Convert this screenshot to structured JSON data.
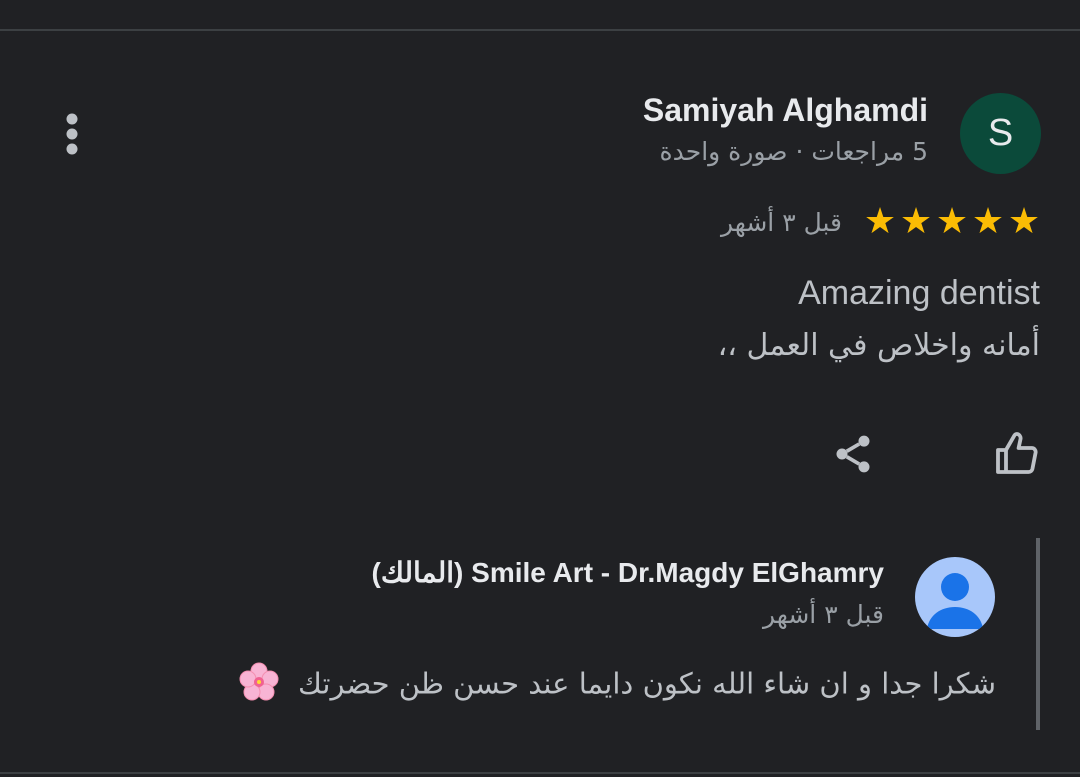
{
  "review": {
    "reviewer_name": "Samiyah Alghamdi",
    "reviewer_initial": "S",
    "reviewer_meta": "5 مراجعات · صورة واحدة",
    "rating": 5,
    "rating_max": 5,
    "star_glyph": "★",
    "date": "قبل ٣ أشهر",
    "text_en": "Amazing dentist",
    "text_ar": "أمانه واخلاص في العمل ،،",
    "avatar_color": "#0b4a3a",
    "star_color": "#fbbc04"
  },
  "actions": {
    "like_icon": "thumb-up-icon",
    "share_icon": "share-icon",
    "more_icon": "more-vert-icon"
  },
  "owner_reply": {
    "owner_name": "Smile Art - Dr.Magdy ElGhamry (المالك)",
    "date": "قبل ٣ أشهر",
    "text": "شكرا جدا و ان شاء الله نكون دايما عند حسن ظن حضرتك",
    "emoji_icon": "cherry-blossom-icon",
    "avatar_color": "#a8c7fa"
  }
}
